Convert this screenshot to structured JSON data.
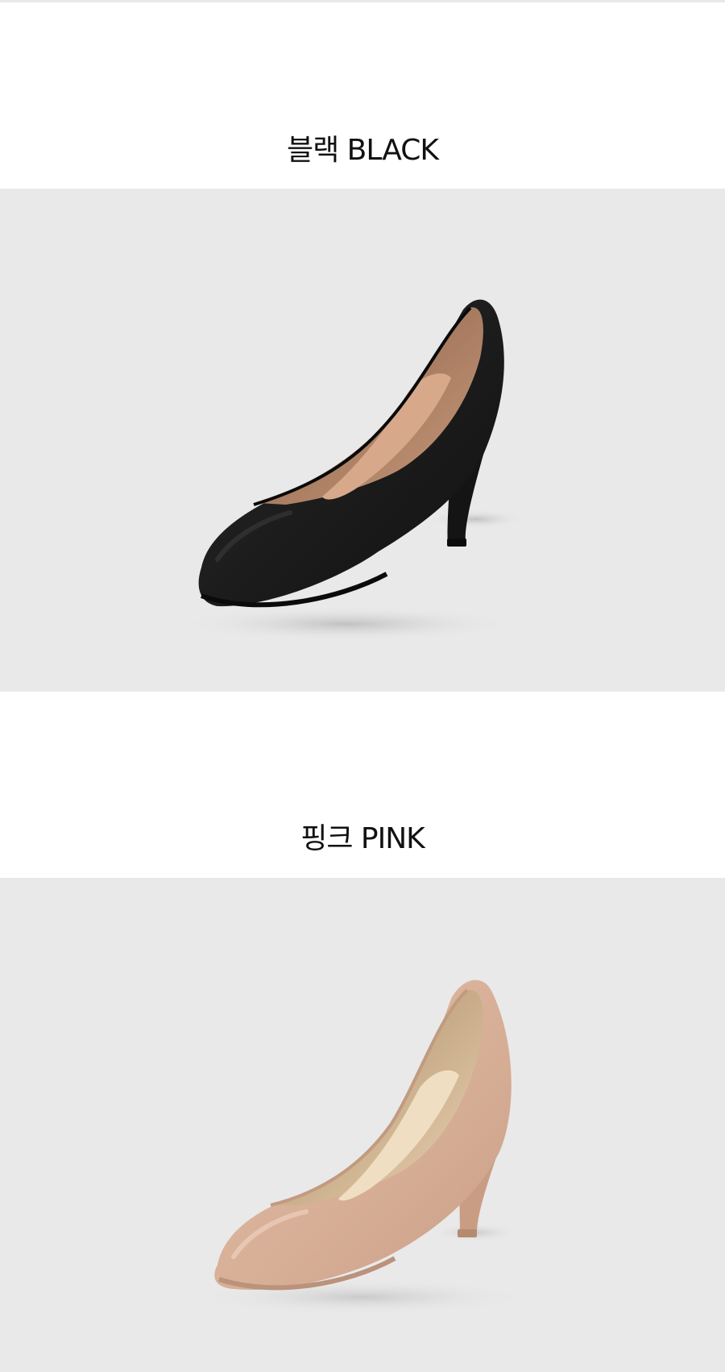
{
  "sections": [
    {
      "title": "블랙 BLACK",
      "image": "black-pump-shoe",
      "colors": {
        "leather": "#1b1b1b",
        "lining": "#b98868",
        "background": "#e9e9ea"
      }
    },
    {
      "title": "핑크 PINK",
      "image": "pink-pump-shoe",
      "colors": {
        "leather": "#d9b19a",
        "lining": "#e8cfae",
        "background": "#e9e9ea"
      }
    }
  ]
}
